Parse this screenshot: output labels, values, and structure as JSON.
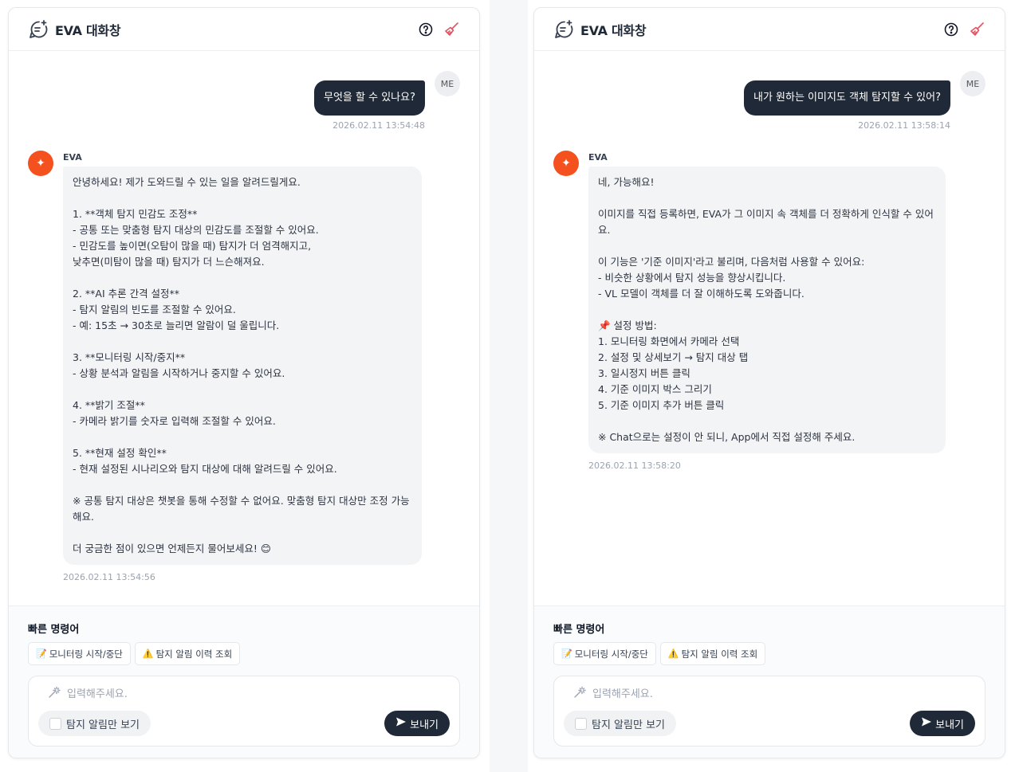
{
  "icons": {
    "header": "chat-sparkle-icon",
    "help": "help-circle-icon",
    "clear": "broom-icon",
    "bot_avatar": "sparkle-icon",
    "input": "magic-wand-icon",
    "send": "send-icon"
  },
  "colors": {
    "primary_dark": "#1f2937",
    "bot_accent": "#f4511e",
    "clear_icon": "#e25563"
  },
  "panels": [
    {
      "header": {
        "title": "EVA 대화창"
      },
      "user": {
        "avatar": "ME",
        "message": "무엇을 할 수 있나요?",
        "time": "2026.02.11 13:54:48"
      },
      "bot": {
        "name": "EVA",
        "message": "안녕하세요! 제가 도와드릴 수 있는 일을 알려드릴게요.\n\n1. **객체 탐지 민감도 조정**\n- 공통 또는 맞춤형 탐지 대상의 민감도를 조절할 수 있어요.\n- 민감도를 높이면(오탐이 많을 때) 탐지가 더 엄격해지고,\n낮추면(미탐이 많을 때) 탐지가 더 느슨해져요.\n\n2. **AI 추론 간격 설정**\n- 탐지 알림의 빈도를 조절할 수 있어요.\n- 예: 15초 → 30초로 늘리면 알람이 덜 울립니다.\n\n3. **모니터링 시작/중지**\n- 상황 분석과 알림을 시작하거나 중지할 수 있어요.\n\n4. **밝기 조절**\n- 카메라 밝기를 숫자로 입력해 조절할 수 있어요.\n\n5. **현재 설정 확인**\n- 현재 설정된 시나리오와 탐지 대상에 대해 알려드릴 수 있어요.\n\n※ 공통 탐지 대상은 챗봇을 통해 수정할 수 없어요. 맞춤형 탐지 대상만 조정 가능해요.\n\n더 궁금한 점이 있으면 언제든지 물어보세요! 😊",
        "time": "2026.02.11 13:54:56"
      },
      "quick": {
        "title": "빠른 명령어",
        "chips": [
          {
            "icon": "📝",
            "label": "모니터링 시작/중단"
          },
          {
            "icon": "⚠️",
            "label": "탐지 알림 이력 조회"
          }
        ]
      },
      "input": {
        "placeholder": "입력해주세요.",
        "value": "",
        "toggle_label": "탐지 알림만 보기",
        "send_label": "보내기"
      }
    },
    {
      "header": {
        "title": "EVA 대화창"
      },
      "user": {
        "avatar": "ME",
        "message": "내가 원하는 이미지도 객체 탐지할 수 있어?",
        "time": "2026.02.11 13:58:14"
      },
      "bot": {
        "name": "EVA",
        "message": "네, 가능해요!\n\n이미지를 직접 등록하면, EVA가 그 이미지 속 객체를 더 정확하게 인식할 수 있어요.\n\n이 기능은 '기준 이미지'라고 불리며, 다음처럼 사용할 수 있어요:\n- 비슷한 상황에서 탐지 성능을 향상시킵니다.\n- VL 모델이 객체를 더 잘 이해하도록 도와줍니다.\n\n📌 설정 방법:\n1. 모니터링 화면에서 카메라 선택\n2. 설정 및 상세보기 → 탐지 대상 탭\n3. 일시정지 버튼 클릭\n4. 기준 이미지 박스 그리기\n5. 기준 이미지 추가 버튼 클릭\n\n※ Chat으로는 설정이 안 되니, App에서 직접 설정해 주세요.",
        "time": "2026.02.11 13:58:20"
      },
      "quick": {
        "title": "빠른 명령어",
        "chips": [
          {
            "icon": "📝",
            "label": "모니터링 시작/중단"
          },
          {
            "icon": "⚠️",
            "label": "탐지 알림 이력 조회"
          }
        ]
      },
      "input": {
        "placeholder": "입력해주세요.",
        "value": "",
        "toggle_label": "탐지 알림만 보기",
        "send_label": "보내기"
      }
    }
  ]
}
